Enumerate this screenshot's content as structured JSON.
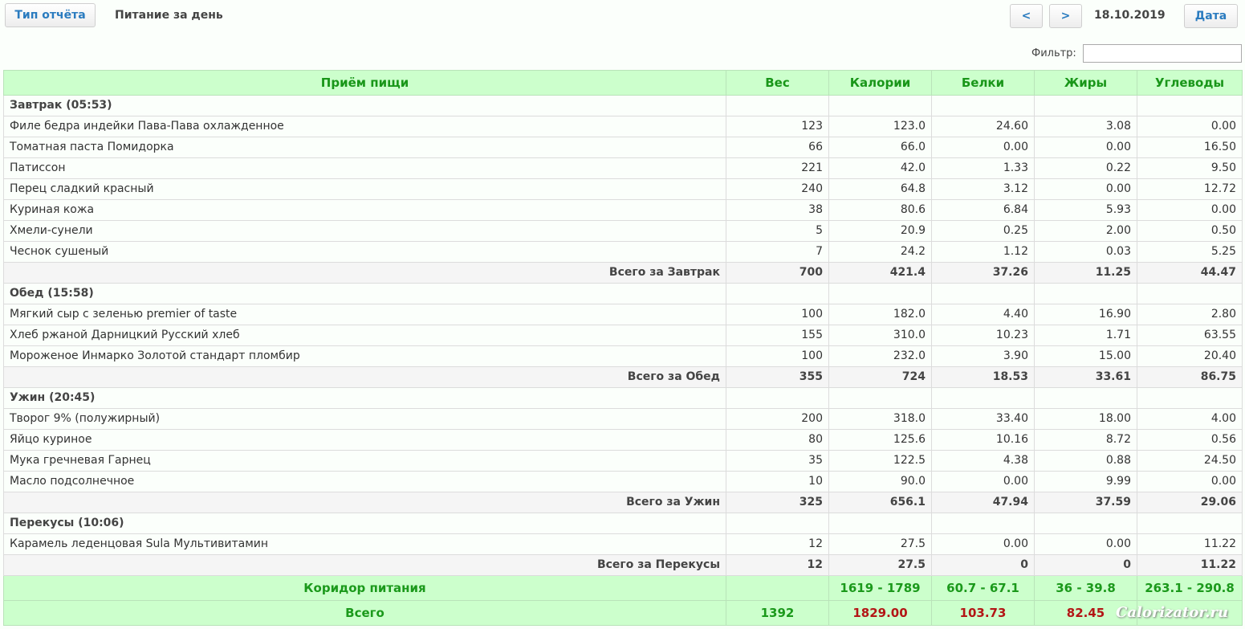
{
  "toolbar": {
    "report_type_label": "Тип отчёта",
    "title": "Питание за день",
    "prev_label": "<",
    "next_label": ">",
    "date": "18.10.2019",
    "date_button_label": "Дата"
  },
  "filter": {
    "label": "Фильтр:",
    "value": ""
  },
  "table": {
    "headers": [
      "Приём пищи",
      "Вес",
      "Калории",
      "Белки",
      "Жиры",
      "Углеводы"
    ],
    "meals": [
      {
        "title": "Завтрак (05:53)",
        "items": [
          [
            "Филе бедра индейки Пава-Пава охлажденное",
            "123",
            "123.0",
            "24.60",
            "3.08",
            "0.00"
          ],
          [
            "Томатная паста Помидорка",
            "66",
            "66.0",
            "0.00",
            "0.00",
            "16.50"
          ],
          [
            "Патиссон",
            "221",
            "42.0",
            "1.33",
            "0.22",
            "9.50"
          ],
          [
            "Перец сладкий красный",
            "240",
            "64.8",
            "3.12",
            "0.00",
            "12.72"
          ],
          [
            "Куриная кожа",
            "38",
            "80.6",
            "6.84",
            "5.93",
            "0.00"
          ],
          [
            "Хмели-сунели",
            "5",
            "20.9",
            "0.25",
            "2.00",
            "0.50"
          ],
          [
            "Чеснок сушеный",
            "7",
            "24.2",
            "1.12",
            "0.03",
            "5.25"
          ]
        ],
        "total": [
          "Всего за Завтрак",
          "700",
          "421.4",
          "37.26",
          "11.25",
          "44.47"
        ]
      },
      {
        "title": "Обед (15:58)",
        "items": [
          [
            "Мягкий сыр с зеленью premier of taste",
            "100",
            "182.0",
            "4.40",
            "16.90",
            "2.80"
          ],
          [
            "Хлеб ржаной Дарницкий Русский хлеб",
            "155",
            "310.0",
            "10.23",
            "1.71",
            "63.55"
          ],
          [
            "Мороженое Инмарко Золотой стандарт пломбир",
            "100",
            "232.0",
            "3.90",
            "15.00",
            "20.40"
          ]
        ],
        "total": [
          "Всего за Обед",
          "355",
          "724",
          "18.53",
          "33.61",
          "86.75"
        ]
      },
      {
        "title": "Ужин (20:45)",
        "items": [
          [
            "Творог 9% (полужирный)",
            "200",
            "318.0",
            "33.40",
            "18.00",
            "4.00"
          ],
          [
            "Яйцо куриное",
            "80",
            "125.6",
            "10.16",
            "8.72",
            "0.56"
          ],
          [
            "Мука гречневая Гарнец",
            "35",
            "122.5",
            "4.38",
            "0.88",
            "24.50"
          ],
          [
            "Масло подсолнечное",
            "10",
            "90.0",
            "0.00",
            "9.99",
            "0.00"
          ]
        ],
        "total": [
          "Всего за Ужин",
          "325",
          "656.1",
          "47.94",
          "37.59",
          "29.06"
        ]
      },
      {
        "title": "Перекусы (10:06)",
        "items": [
          [
            "Карамель леденцовая Sula Мультивитамин",
            "12",
            "27.5",
            "0.00",
            "0.00",
            "11.22"
          ]
        ],
        "total": [
          "Всего за Перекусы",
          "12",
          "27.5",
          "0",
          "0",
          "11.22"
        ]
      }
    ],
    "corridor": [
      "Коридор питания",
      "",
      "1619 - 1789",
      "60.7 - 67.1",
      "36 - 39.8",
      "263.1 - 290.8"
    ],
    "grand_total": [
      "Всего",
      "1392",
      "1829.00",
      "103.73",
      "82.45",
      ""
    ]
  },
  "watermark": "Calorizator.ru",
  "colors": {
    "header_bg": "#ccffcc",
    "header_text": "#199619",
    "over_limit_text": "#b31515",
    "button_text": "#2a7bbf"
  }
}
